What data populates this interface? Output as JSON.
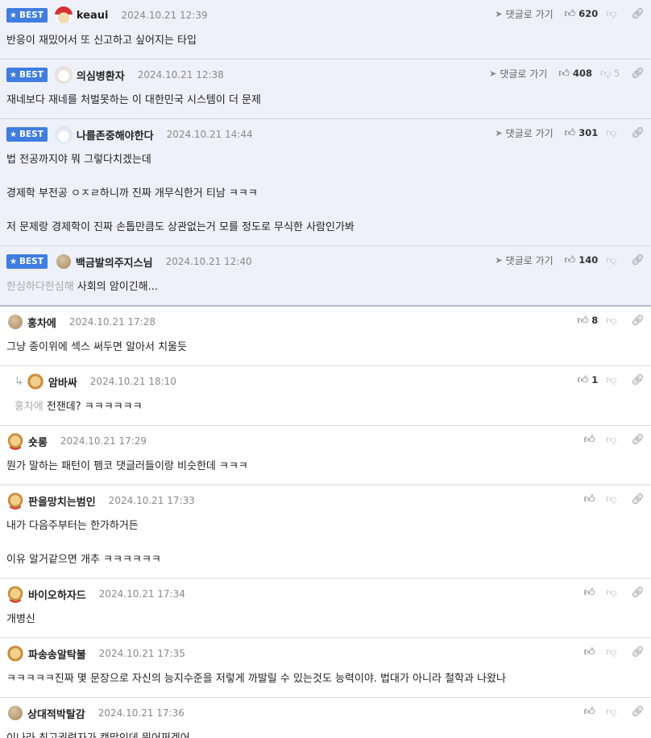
{
  "ui": {
    "best_label": "BEST",
    "goto_label": "댓글로 가기"
  },
  "comments": [
    {
      "best": true,
      "nick": "keaui",
      "date": "2024.10.21 12:39",
      "likes": "620",
      "dislikes": "",
      "avatar": "santa-dog",
      "lines": [
        "반응이 재밌어서 또 신고하고 싶어지는 타입"
      ]
    },
    {
      "best": true,
      "nick": "의심병환자",
      "date": "2024.10.21 12:38",
      "likes": "408",
      "dislikes": "5",
      "avatar": "white-dog",
      "lines": [
        "재네보다 재네를 처벌못하는 이 대한민국 시스템이 더 문제"
      ]
    },
    {
      "best": true,
      "nick": "나를존중해야한다",
      "date": "2024.10.21 14:44",
      "likes": "301",
      "dislikes": "",
      "avatar": "polar-bear",
      "lines": [
        "법 전공까지야 뭐 그렇다치겠는데",
        "",
        "경제학 부전공 ㅇㅈㄹ하니까 진짜 개무식한거 티남 ㅋㅋㅋ",
        "",
        "저 문제랑 경제학이 진짜 손톱만큼도 상관없는거 모를 정도로 무식한 사람인가봐"
      ]
    },
    {
      "best": true,
      "nick": "백금발의주지스님",
      "date": "2024.10.21 12:40",
      "likes": "140",
      "dislikes": "",
      "avatar": "dot",
      "mention": "한심하다한심해",
      "lines": [
        "사회의 암이긴해..."
      ]
    },
    {
      "best": false,
      "nick": "홍차에",
      "date": "2024.10.21 17:28",
      "likes": "8",
      "dislikes": "",
      "avatar": "dot",
      "lines": [
        "그냥 종이위에 섹스 써두면 알아서 치울듯"
      ]
    },
    {
      "best": false,
      "reply": true,
      "nick": "암바싸",
      "date": "2024.10.21 18:10",
      "likes": "1",
      "dislikes": "",
      "avatar": "puppy-plain",
      "mention": "홍차에",
      "lines": [
        "전잰데? ㅋㅋㅋㅋㅋㅋ"
      ]
    },
    {
      "best": false,
      "nick": "숏롱",
      "date": "2024.10.21 17:29",
      "likes": "",
      "dislikes": "",
      "avatar": "puppy",
      "lines": [
        "뭔가 말하는 패턴이 펨코 댓글러들이랑 비슷한데 ㅋㅋㅋ"
      ]
    },
    {
      "best": false,
      "nick": "판을망치는범인",
      "date": "2024.10.21 17:33",
      "likes": "",
      "dislikes": "",
      "avatar": "puppy",
      "lines": [
        "내가 다음주부터는 한가하거든",
        "",
        "이유 알거같으면 개추 ㅋㅋㅋㅋㅋㅋ"
      ]
    },
    {
      "best": false,
      "nick": "바이오하자드",
      "date": "2024.10.21 17:34",
      "likes": "",
      "dislikes": "",
      "avatar": "puppy",
      "lines": [
        "개병신"
      ]
    },
    {
      "best": false,
      "nick": "파송송알탁불",
      "date": "2024.10.21 17:35",
      "likes": "",
      "dislikes": "",
      "avatar": "puppy-plain",
      "lines": [
        "ㅋㅋㅋㅋㅋ진짜 몇 문장으로 자신의 능지수준을 저렇게 까발릴 수 있는것도 능력이야. 법대가 아니라 철학과 나왔나"
      ]
    },
    {
      "best": false,
      "nick": "상대적박탈감",
      "date": "2024.10.21 17:36",
      "likes": "",
      "dislikes": "",
      "avatar": "dot",
      "lines": [
        "이나라 최고권력자가 캣맘인데 뭐어쩌겠어"
      ]
    }
  ]
}
